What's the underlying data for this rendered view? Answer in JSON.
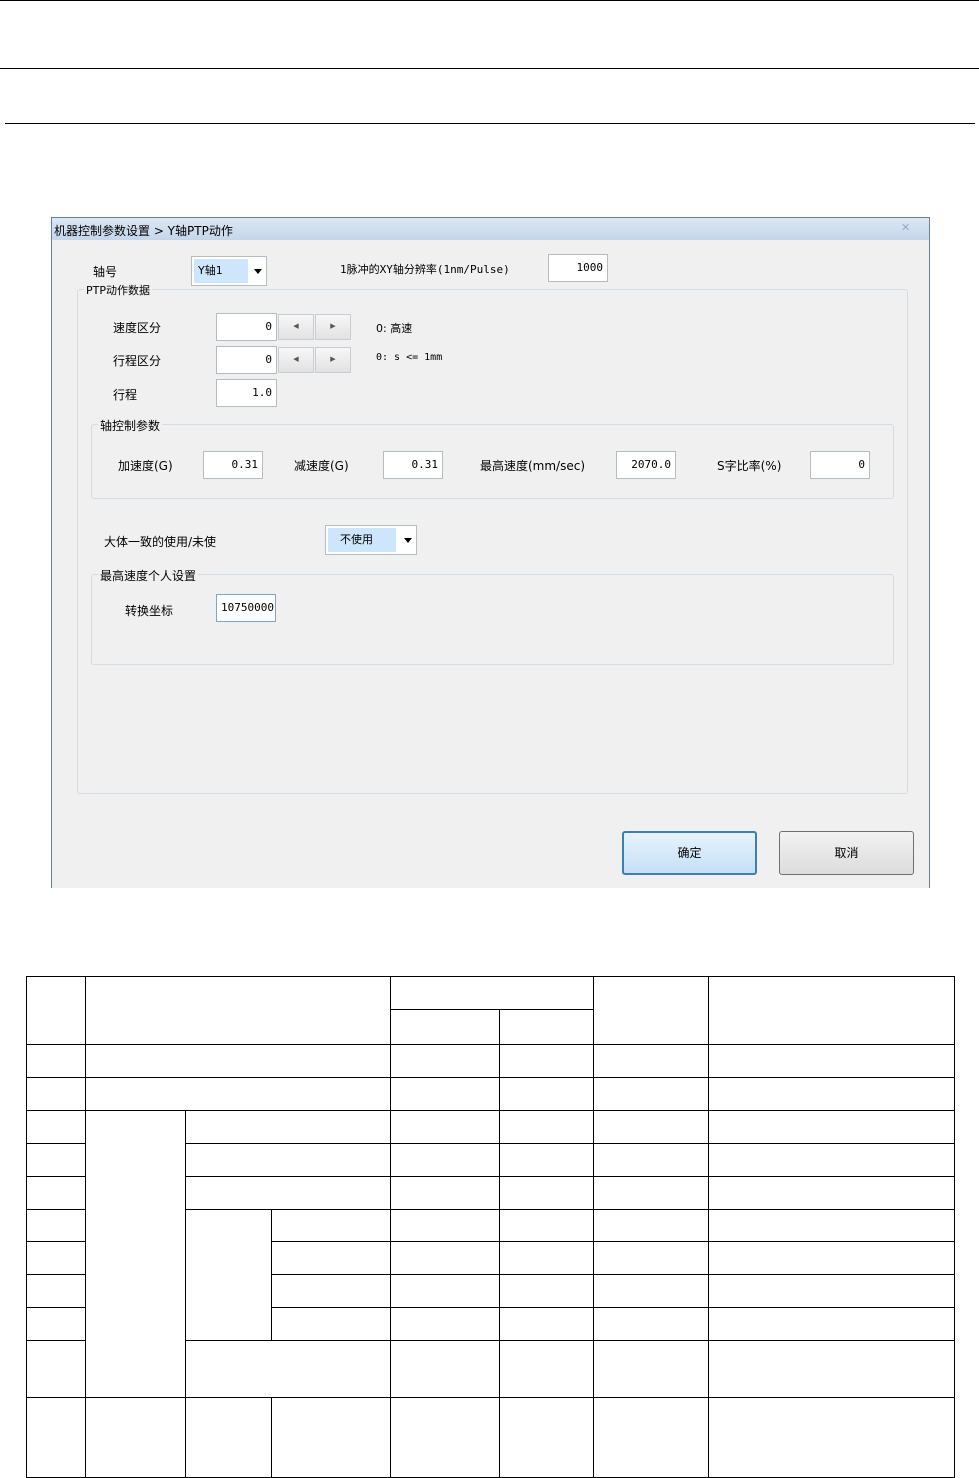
{
  "dialog": {
    "title": "机器控制参数设置 > Y轴PTP动作",
    "axis_label": "轴号",
    "axis_value": "Y轴1",
    "resolution_label": "1脉冲的XY轴分辨率(1nm/Pulse)",
    "resolution_value": "1000",
    "ptp_group": {
      "title": "PTP动作数据",
      "speed_div_label": "速度区分",
      "speed_div_value": "0",
      "speed_div_note": "0: 高速",
      "stroke_div_label": "行程区分",
      "stroke_div_value": "0",
      "stroke_div_note": "0: s <= 1mm",
      "stroke_label": "行程",
      "stroke_value": "1.0"
    },
    "axis_ctrl": {
      "title": "轴控制参数",
      "accel_label": "加速度(G)",
      "accel_value": "0.31",
      "decel_label": "减速度(G)",
      "decel_value": "0.31",
      "maxspeed_label": "最高速度(mm/sec)",
      "maxspeed_value": "2070.0",
      "sratio_label": "S字比率(%)",
      "sratio_value": "0"
    },
    "usage_label": "大体一致的使用/未使",
    "usage_value": "不使用",
    "max_speed_group": {
      "title": "最高速度个人设置",
      "coord_label": "转换坐标",
      "coord_value": "10750000"
    },
    "ok_label": "确定",
    "cancel_label": "取消"
  }
}
